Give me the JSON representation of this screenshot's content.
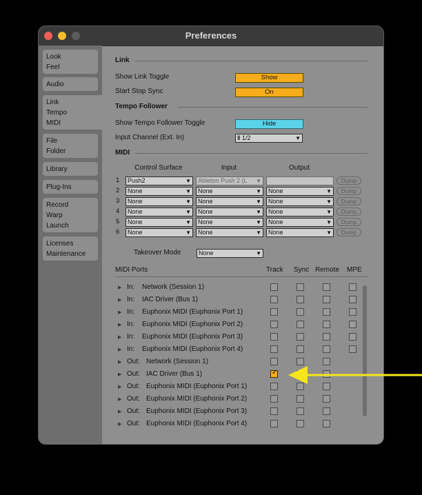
{
  "window": {
    "title": "Preferences"
  },
  "sidebar": {
    "tabs": [
      {
        "lines": [
          "Look",
          "Feel"
        ]
      },
      {
        "lines": [
          "Audio"
        ]
      },
      {
        "lines": [
          "Link",
          "Tempo",
          "MIDI"
        ]
      },
      {
        "lines": [
          "File",
          "Folder"
        ]
      },
      {
        "lines": [
          "Library"
        ]
      },
      {
        "lines": [
          "Plug-Ins"
        ]
      },
      {
        "lines": [
          "Record",
          "Warp",
          "Launch"
        ]
      },
      {
        "lines": [
          "Licenses",
          "Maintenance"
        ]
      }
    ]
  },
  "link": {
    "section": "Link",
    "toggle_label": "Show Link Toggle",
    "toggle_value": "Show",
    "sync_label": "Start Stop Sync",
    "sync_value": "On"
  },
  "tempo": {
    "section": "Tempo Follower",
    "toggle_label": "Show Tempo Follower Toggle",
    "toggle_value": "Hide",
    "input_label": "Input Channel (Ext. In)",
    "input_value": "1/2"
  },
  "midi": {
    "section": "MIDI",
    "col_control": "Control Surface",
    "col_input": "Input",
    "col_output": "Output",
    "dump_label": "Dump",
    "rows": [
      {
        "index": "1",
        "control": "Push2",
        "input": "Ableton Push 2 (L",
        "output": ""
      },
      {
        "index": "2",
        "control": "None",
        "input": "None",
        "output": "None"
      },
      {
        "index": "3",
        "control": "None",
        "input": "None",
        "output": "None"
      },
      {
        "index": "4",
        "control": "None",
        "input": "None",
        "output": "None"
      },
      {
        "index": "5",
        "control": "None",
        "input": "None",
        "output": "None"
      },
      {
        "index": "6",
        "control": "None",
        "input": "None",
        "output": "None"
      }
    ],
    "takeover_label": "Takeover Mode",
    "takeover_value": "None"
  },
  "ports": {
    "header": "MIDI Ports",
    "col_track": "Track",
    "col_sync": "Sync",
    "col_remote": "Remote",
    "col_mpe": "MPE",
    "rows": [
      {
        "dir": "In:",
        "name": "Network (Session 1)",
        "track": false,
        "sync": false,
        "remote": false,
        "mpe": false
      },
      {
        "dir": "In:",
        "name": "IAC Driver (Bus 1)",
        "track": false,
        "sync": false,
        "remote": false,
        "mpe": false
      },
      {
        "dir": "In:",
        "name": "Euphonix MIDI (Euphonix Port 1)",
        "track": false,
        "sync": false,
        "remote": false,
        "mpe": false
      },
      {
        "dir": "In:",
        "name": "Euphonix MIDI (Euphonix Port 2)",
        "track": false,
        "sync": false,
        "remote": false,
        "mpe": false
      },
      {
        "dir": "In:",
        "name": "Euphonix MIDI (Euphonix Port 3)",
        "track": false,
        "sync": false,
        "remote": false,
        "mpe": false
      },
      {
        "dir": "In:",
        "name": "Euphonix MIDI (Euphonix Port 4)",
        "track": false,
        "sync": false,
        "remote": false,
        "mpe": false
      },
      {
        "dir": "Out:",
        "name": "Network (Session 1)",
        "track": false,
        "sync": false,
        "remote": false
      },
      {
        "dir": "Out:",
        "name": "IAC Driver (Bus 1)",
        "track": true,
        "sync": false,
        "remote": false
      },
      {
        "dir": "Out:",
        "name": "Euphonix MIDI (Euphonix Port 1)",
        "track": false,
        "sync": false,
        "remote": false
      },
      {
        "dir": "Out:",
        "name": "Euphonix MIDI (Euphonix Port 2)",
        "track": false,
        "sync": false,
        "remote": false
      },
      {
        "dir": "Out:",
        "name": "Euphonix MIDI (Euphonix Port 3)",
        "track": false,
        "sync": false,
        "remote": false
      },
      {
        "dir": "Out:",
        "name": "Euphonix MIDI (Euphonix Port 4)",
        "track": false,
        "sync": false,
        "remote": false
      }
    ]
  },
  "colors": {
    "accent_orange": "#f7ac1b",
    "accent_cyan": "#5ad3e9",
    "annotation_arrow": "#f5e61a"
  },
  "icons": {
    "expand": "triangle-right-icon",
    "dropdown": "triangle-down-icon",
    "annotation": "arrow-left-icon"
  }
}
